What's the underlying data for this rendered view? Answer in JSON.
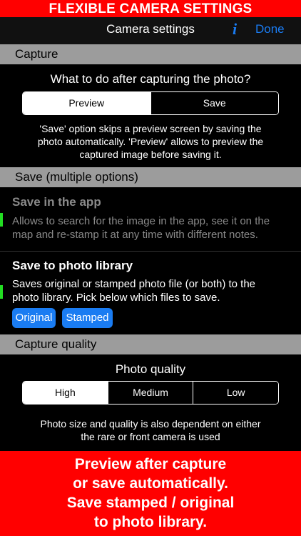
{
  "top_banner": "FLEXIBLE CAMERA SETTINGS",
  "navbar": {
    "title": "Camera settings",
    "info_icon": "i",
    "done_label": "Done"
  },
  "capture_section": {
    "header": "Capture",
    "question": "What to do after capturing the photo?",
    "options": [
      "Preview",
      "Save"
    ],
    "selected": "Preview",
    "help_lines": [
      "'Save' option skips a preview screen by saving the",
      "photo automatically. 'Preview' allows to preview the",
      "captured image before saving it."
    ]
  },
  "save_section": {
    "header": "Save (multiple options)",
    "app": {
      "title": "Save in the app",
      "desc_lines": [
        "Allows to search for the image in the app, see it on the",
        "map and re-stamp it at any time with different notes."
      ]
    },
    "library": {
      "title": "Save to photo library",
      "desc_lines": [
        "Saves original or stamped photo file (or both) to the",
        "photo library. Pick below which files to save."
      ],
      "buttons": [
        "Original",
        "Stamped"
      ]
    }
  },
  "quality_section": {
    "header": "Capture quality",
    "label": "Photo quality",
    "options": [
      "High",
      "Medium",
      "Low"
    ],
    "selected": "High",
    "note_lines": [
      "Photo size and quality is also dependent on either",
      "the rare or front camera is used"
    ]
  },
  "bottom_banner": [
    "Preview after capture",
    "or save automatically.",
    "Save stamped / original",
    "to photo library."
  ],
  "colors": {
    "banner_red": "#ff0000",
    "accent_blue": "#1a7cf2",
    "marker_green": "#22dd22",
    "section_gray": "#9c9c9c"
  }
}
